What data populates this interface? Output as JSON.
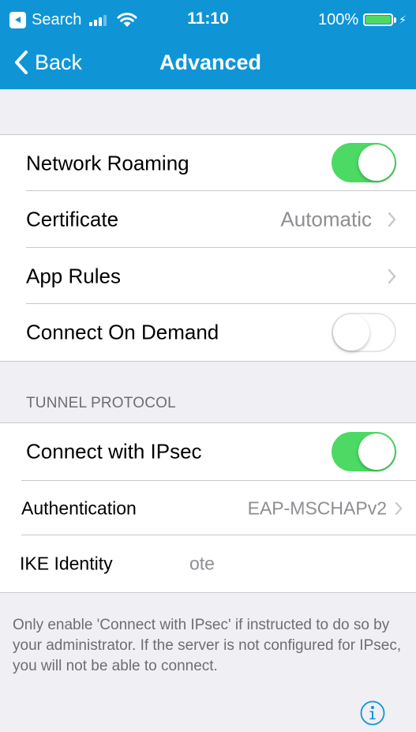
{
  "status_bar": {
    "back_app": "Search",
    "time": "11:10",
    "battery": "100%",
    "signal_bars_filled": 3,
    "signal_bars_total": 4,
    "battery_level": 1.0
  },
  "nav": {
    "back_label": "Back",
    "title": "Advanced"
  },
  "settings": {
    "network_roaming": {
      "label": "Network Roaming",
      "enabled": true
    },
    "certificate": {
      "label": "Certificate",
      "value": "Automatic"
    },
    "app_rules": {
      "label": "App Rules"
    },
    "connect_on_demand": {
      "label": "Connect On Demand",
      "enabled": false
    }
  },
  "tunnel": {
    "header": "TUNNEL PROTOCOL",
    "connect_ipsec": {
      "label": "Connect with IPsec",
      "enabled": true
    },
    "authentication": {
      "label": "Authentication",
      "value": "EAP-MSCHAPv2"
    },
    "ike_identity": {
      "label": "IKE Identity",
      "value": "ote"
    }
  },
  "footer_note": "Only enable 'Connect with IPsec' if instructed to do so by your administrator. If the server is not configured for IPsec, you will not be able to connect.",
  "icons": {
    "back": "chevron-left-icon",
    "disclosure": "chevron-right-icon",
    "info": "info-icon",
    "wifi": "wifi-icon",
    "battery": "battery-icon",
    "charging": "charging-bolt-icon",
    "signal": "signal-icon"
  },
  "colors": {
    "nav_bar": "#0f95d6",
    "toggle_on": "#4cd964",
    "battery_fill": "#4cd964",
    "background": "#efeff4",
    "secondary_text": "#8e8e93",
    "section_text": "#6d6d72",
    "info_icon": "#0f95d6"
  }
}
